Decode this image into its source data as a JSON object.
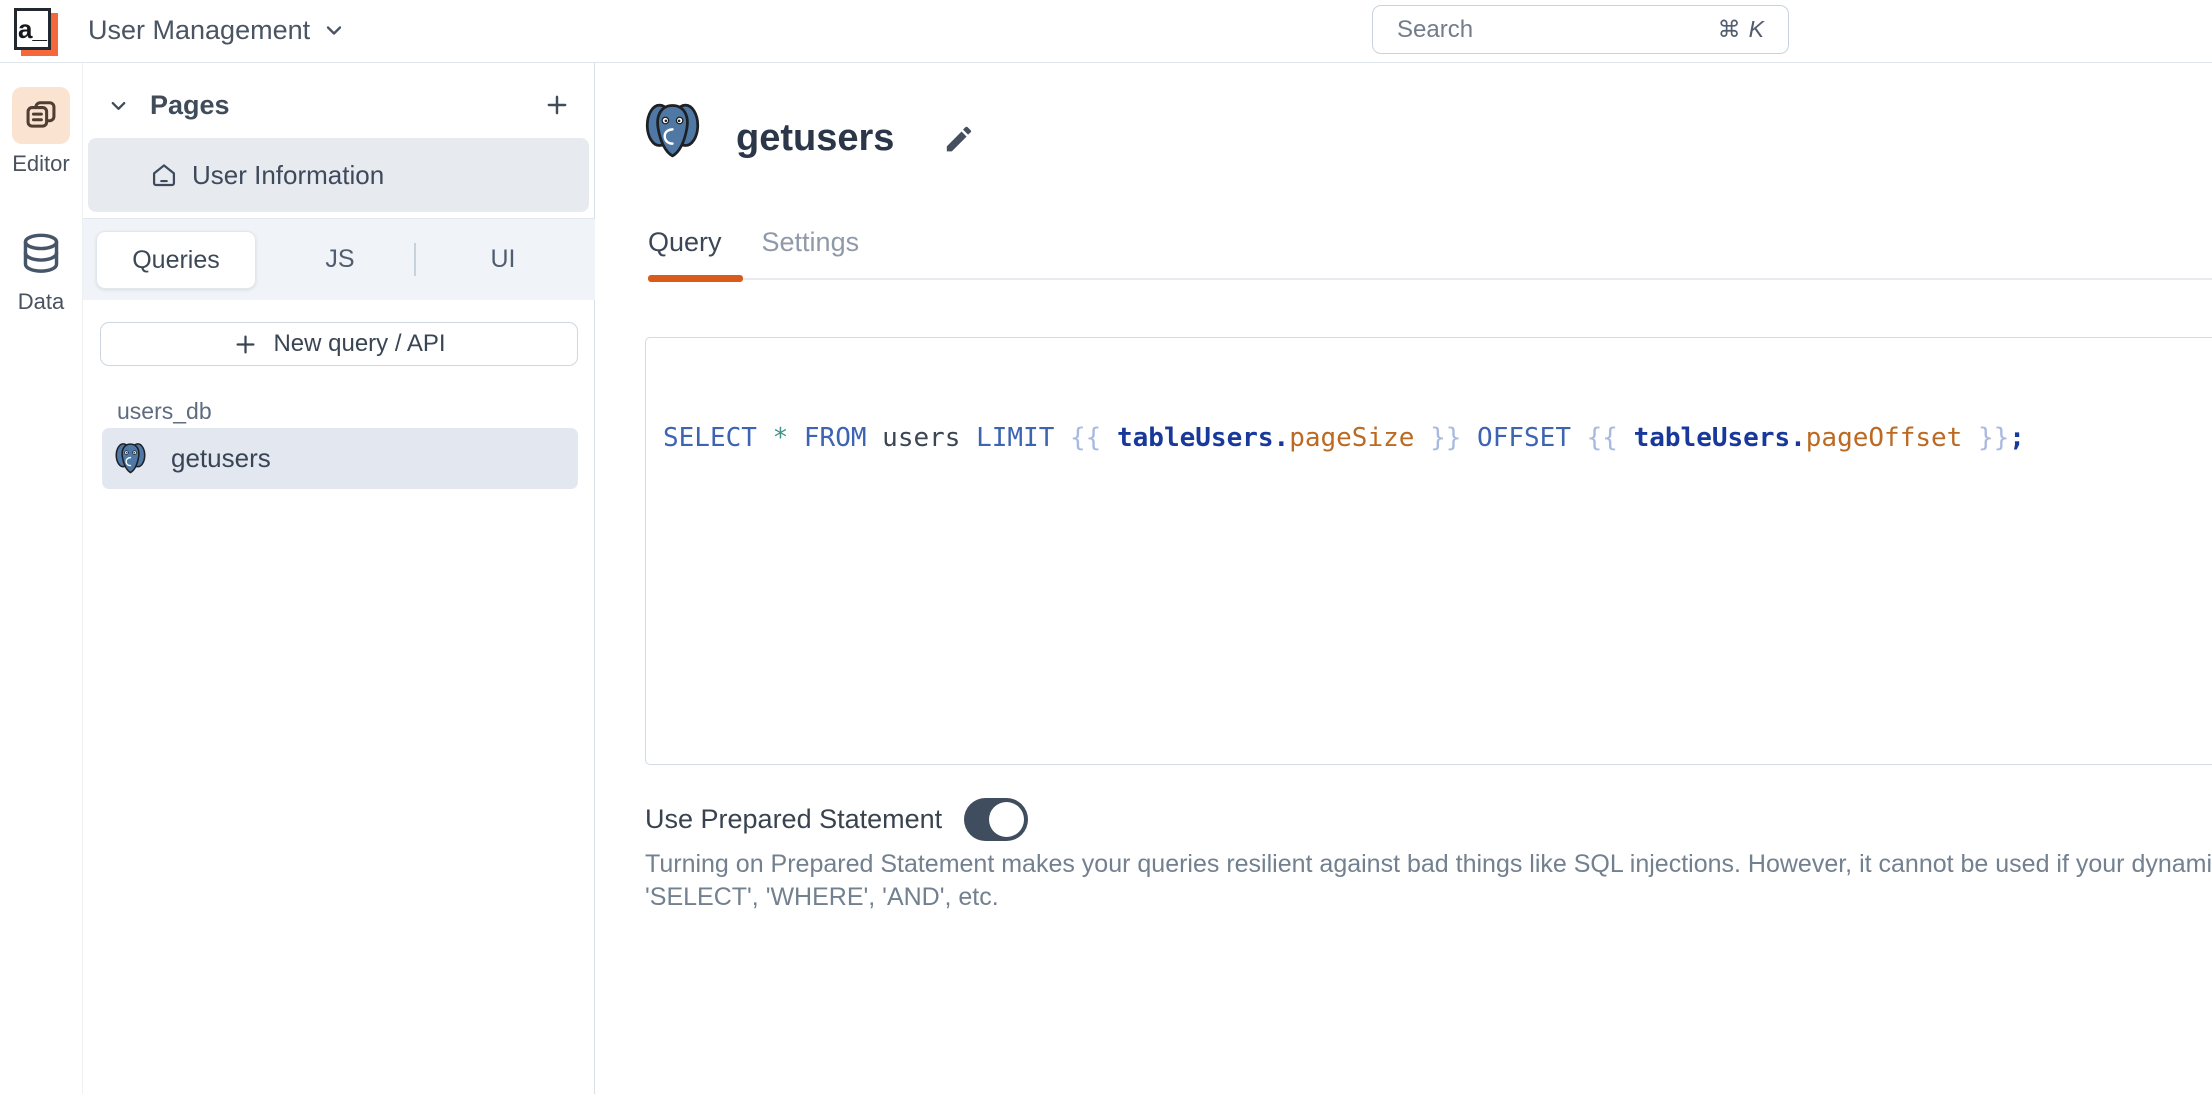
{
  "topbar": {
    "logo_text": "a_",
    "app_title": "User Management",
    "search": {
      "placeholder": "Search",
      "shortcut_cmd": "⌘",
      "shortcut_key": "K"
    }
  },
  "rail": {
    "items": [
      {
        "label": "Editor"
      },
      {
        "label": "Data"
      }
    ]
  },
  "sidebar": {
    "pages_header": "Pages",
    "pages": [
      {
        "label": "User Information"
      }
    ],
    "tabs": [
      {
        "label": "Queries"
      },
      {
        "label": "JS"
      },
      {
        "label": "UI"
      }
    ],
    "new_query_button": "New query / API",
    "groups": [
      {
        "name": "users_db",
        "items": [
          {
            "label": "getusers"
          }
        ]
      }
    ]
  },
  "main": {
    "query_title": "getusers",
    "tabs": [
      {
        "label": "Query"
      },
      {
        "label": "Settings"
      }
    ],
    "code": {
      "tokens": [
        {
          "t": "SELECT",
          "c": "kw"
        },
        {
          "t": " ",
          "c": "pl"
        },
        {
          "t": "*",
          "c": "op"
        },
        {
          "t": " ",
          "c": "pl"
        },
        {
          "t": "FROM",
          "c": "kw"
        },
        {
          "t": " users ",
          "c": "pl"
        },
        {
          "t": "LIMIT",
          "c": "kw"
        },
        {
          "t": " ",
          "c": "pl"
        },
        {
          "t": "{{",
          "c": "br"
        },
        {
          "t": " ",
          "c": "pl"
        },
        {
          "t": "tableUsers.",
          "c": "obj"
        },
        {
          "t": "pageSize",
          "c": "prop"
        },
        {
          "t": " ",
          "c": "pl"
        },
        {
          "t": "}}",
          "c": "br"
        },
        {
          "t": " ",
          "c": "pl"
        },
        {
          "t": "OFFSET",
          "c": "kw"
        },
        {
          "t": " ",
          "c": "pl"
        },
        {
          "t": "{{",
          "c": "br"
        },
        {
          "t": " ",
          "c": "pl"
        },
        {
          "t": "tableUsers.",
          "c": "obj"
        },
        {
          "t": "pageOffset",
          "c": "prop"
        },
        {
          "t": " ",
          "c": "pl"
        },
        {
          "t": "}}",
          "c": "br"
        },
        {
          "t": ";",
          "c": "semi"
        }
      ]
    },
    "prepared": {
      "label": "Use Prepared Statement",
      "toggle_state": "on",
      "description_line1": "Turning on Prepared Statement makes your queries resilient against bad things like SQL injections. However, it cannot be used if your dynamic bi",
      "description_line2": "'SELECT', 'WHERE', 'AND', etc."
    }
  },
  "colors": {
    "accent_orange": "#DA5A1B",
    "logo_orange": "#F4683C",
    "editor_icon_bg": "#FBE3D1",
    "editor_icon_fg": "#4F3E33",
    "postgres_blue": "#4F79A4",
    "toggle_on": "#3F4D5F",
    "selected_row_bg": "#E7EAEF",
    "query_row_bg": "#E3E8F0",
    "syntax_keyword": "#3D64B3",
    "syntax_star": "#3D9488",
    "syntax_plain": "#3C4654",
    "syntax_braces": "#A9BAE0",
    "syntax_object": "#18399B",
    "syntax_property": "#BC6A22"
  }
}
